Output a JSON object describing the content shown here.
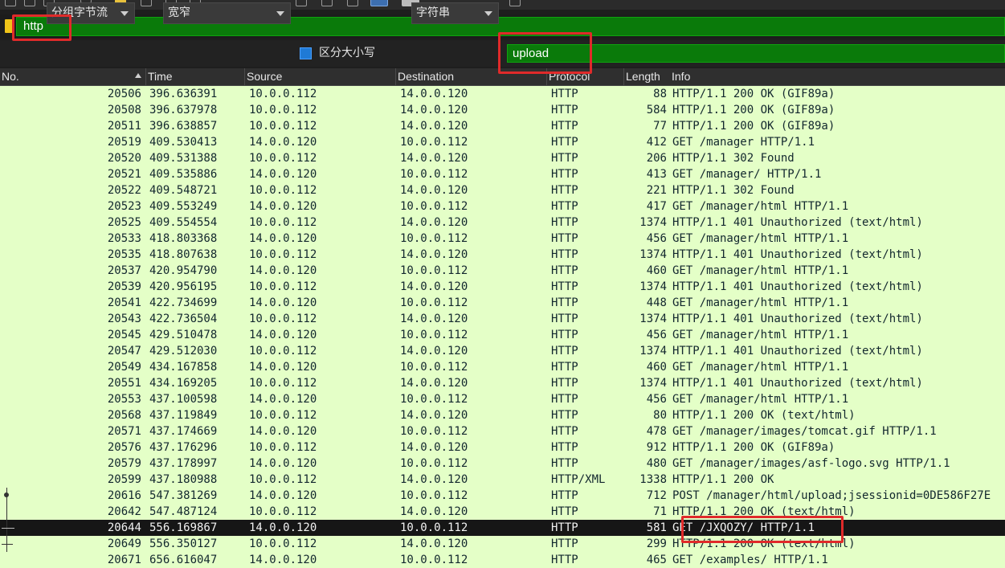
{
  "display_filter": {
    "value": "http"
  },
  "find_bar": {
    "search_in": "分组字节流",
    "char_width": "宽窄",
    "case_sensitive_label": "区分大小写",
    "search_type": "字符串",
    "search_value": "upload"
  },
  "columns": [
    "No.",
    "Time",
    "Source",
    "Destination",
    "Protocol",
    "Length",
    "Info"
  ],
  "rows": [
    {
      "no": "20506",
      "time": "396.636391",
      "src": "10.0.0.112",
      "dst": "14.0.0.120",
      "proto": "HTTP",
      "len": "88",
      "info": "HTTP/1.1 200 OK  (GIF89a)"
    },
    {
      "no": "20508",
      "time": "396.637978",
      "src": "10.0.0.112",
      "dst": "14.0.0.120",
      "proto": "HTTP",
      "len": "584",
      "info": "HTTP/1.1 200 OK  (GIF89a)"
    },
    {
      "no": "20511",
      "time": "396.638857",
      "src": "10.0.0.112",
      "dst": "14.0.0.120",
      "proto": "HTTP",
      "len": "77",
      "info": "HTTP/1.1 200 OK  (GIF89a)"
    },
    {
      "no": "20519",
      "time": "409.530413",
      "src": "14.0.0.120",
      "dst": "10.0.0.112",
      "proto": "HTTP",
      "len": "412",
      "info": "GET /manager HTTP/1.1"
    },
    {
      "no": "20520",
      "time": "409.531388",
      "src": "10.0.0.112",
      "dst": "14.0.0.120",
      "proto": "HTTP",
      "len": "206",
      "info": "HTTP/1.1 302 Found"
    },
    {
      "no": "20521",
      "time": "409.535886",
      "src": "14.0.0.120",
      "dst": "10.0.0.112",
      "proto": "HTTP",
      "len": "413",
      "info": "GET /manager/ HTTP/1.1"
    },
    {
      "no": "20522",
      "time": "409.548721",
      "src": "10.0.0.112",
      "dst": "14.0.0.120",
      "proto": "HTTP",
      "len": "221",
      "info": "HTTP/1.1 302 Found"
    },
    {
      "no": "20523",
      "time": "409.553249",
      "src": "14.0.0.120",
      "dst": "10.0.0.112",
      "proto": "HTTP",
      "len": "417",
      "info": "GET /manager/html HTTP/1.1"
    },
    {
      "no": "20525",
      "time": "409.554554",
      "src": "10.0.0.112",
      "dst": "14.0.0.120",
      "proto": "HTTP",
      "len": "1374",
      "info": "HTTP/1.1 401 Unauthorized  (text/html)"
    },
    {
      "no": "20533",
      "time": "418.803368",
      "src": "14.0.0.120",
      "dst": "10.0.0.112",
      "proto": "HTTP",
      "len": "456",
      "info": "GET /manager/html HTTP/1.1"
    },
    {
      "no": "20535",
      "time": "418.807638",
      "src": "10.0.0.112",
      "dst": "14.0.0.120",
      "proto": "HTTP",
      "len": "1374",
      "info": "HTTP/1.1 401 Unauthorized  (text/html)"
    },
    {
      "no": "20537",
      "time": "420.954790",
      "src": "14.0.0.120",
      "dst": "10.0.0.112",
      "proto": "HTTP",
      "len": "460",
      "info": "GET /manager/html HTTP/1.1"
    },
    {
      "no": "20539",
      "time": "420.956195",
      "src": "10.0.0.112",
      "dst": "14.0.0.120",
      "proto": "HTTP",
      "len": "1374",
      "info": "HTTP/1.1 401 Unauthorized  (text/html)"
    },
    {
      "no": "20541",
      "time": "422.734699",
      "src": "14.0.0.120",
      "dst": "10.0.0.112",
      "proto": "HTTP",
      "len": "448",
      "info": "GET /manager/html HTTP/1.1"
    },
    {
      "no": "20543",
      "time": "422.736504",
      "src": "10.0.0.112",
      "dst": "14.0.0.120",
      "proto": "HTTP",
      "len": "1374",
      "info": "HTTP/1.1 401 Unauthorized  (text/html)"
    },
    {
      "no": "20545",
      "time": "429.510478",
      "src": "14.0.0.120",
      "dst": "10.0.0.112",
      "proto": "HTTP",
      "len": "456",
      "info": "GET /manager/html HTTP/1.1"
    },
    {
      "no": "20547",
      "time": "429.512030",
      "src": "10.0.0.112",
      "dst": "14.0.0.120",
      "proto": "HTTP",
      "len": "1374",
      "info": "HTTP/1.1 401 Unauthorized  (text/html)"
    },
    {
      "no": "20549",
      "time": "434.167858",
      "src": "14.0.0.120",
      "dst": "10.0.0.112",
      "proto": "HTTP",
      "len": "460",
      "info": "GET /manager/html HTTP/1.1"
    },
    {
      "no": "20551",
      "time": "434.169205",
      "src": "10.0.0.112",
      "dst": "14.0.0.120",
      "proto": "HTTP",
      "len": "1374",
      "info": "HTTP/1.1 401 Unauthorized  (text/html)"
    },
    {
      "no": "20553",
      "time": "437.100598",
      "src": "14.0.0.120",
      "dst": "10.0.0.112",
      "proto": "HTTP",
      "len": "456",
      "info": "GET /manager/html HTTP/1.1"
    },
    {
      "no": "20568",
      "time": "437.119849",
      "src": "10.0.0.112",
      "dst": "14.0.0.120",
      "proto": "HTTP",
      "len": "80",
      "info": "HTTP/1.1 200 OK  (text/html)"
    },
    {
      "no": "20571",
      "time": "437.174669",
      "src": "14.0.0.120",
      "dst": "10.0.0.112",
      "proto": "HTTP",
      "len": "478",
      "info": "GET /manager/images/tomcat.gif HTTP/1.1"
    },
    {
      "no": "20576",
      "time": "437.176296",
      "src": "10.0.0.112",
      "dst": "14.0.0.120",
      "proto": "HTTP",
      "len": "912",
      "info": "HTTP/1.1 200 OK  (GIF89a)"
    },
    {
      "no": "20579",
      "time": "437.178997",
      "src": "14.0.0.120",
      "dst": "10.0.0.112",
      "proto": "HTTP",
      "len": "480",
      "info": "GET /manager/images/asf-logo.svg HTTP/1.1"
    },
    {
      "no": "20599",
      "time": "437.180988",
      "src": "10.0.0.112",
      "dst": "14.0.0.120",
      "proto": "HTTP/XML",
      "len": "1338",
      "info": "HTTP/1.1 200 OK"
    },
    {
      "no": "20616",
      "time": "547.381269",
      "src": "14.0.0.120",
      "dst": "10.0.0.112",
      "proto": "HTTP",
      "len": "712",
      "info": "POST /manager/html/upload;jsessionid=0DE586F27E"
    },
    {
      "no": "20642",
      "time": "547.487124",
      "src": "10.0.0.112",
      "dst": "14.0.0.120",
      "proto": "HTTP",
      "len": "71",
      "info": "HTTP/1.1 200 OK  (text/html)"
    },
    {
      "no": "20644",
      "time": "556.169867",
      "src": "14.0.0.120",
      "dst": "10.0.0.112",
      "proto": "HTTP",
      "len": "581",
      "info": "GET /JXQOZY/ HTTP/1.1"
    },
    {
      "no": "20649",
      "time": "556.350127",
      "src": "10.0.0.112",
      "dst": "14.0.0.120",
      "proto": "HTTP",
      "len": "299",
      "info": "HTTP/1.1 200 OK  (text/html)"
    },
    {
      "no": "20671",
      "time": "656.616047",
      "src": "14.0.0.120",
      "dst": "10.0.0.112",
      "proto": "HTTP",
      "len": "465",
      "info": "GET /examples/ HTTP/1.1"
    }
  ],
  "selected_row": 27
}
